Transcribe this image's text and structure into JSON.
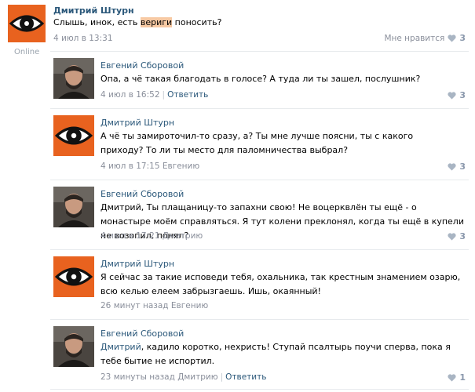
{
  "main": {
    "post": {
      "author": "Дмитрий Штурн",
      "text_before": "Слышь, инок, есть ",
      "text_highlight": "вериги",
      "text_after": " поносить?",
      "timestamp": "4 июл в 13:31",
      "like_label": "Мне нравится",
      "like_count": "3",
      "status": "Online"
    },
    "thread": {
      "comments": [
        {
          "author": "Евгений Сборовой",
          "text": "Опа, а чё такая благодать в голосе? А туда ли ты зашел, послушник?",
          "timestamp": "4 июл в 16:52",
          "reply_label": "Ответить",
          "reply_to": "",
          "like_count": "3"
        },
        {
          "author": "Дмитрий Штурн",
          "text": "А чё ты замироточил-то сразу, а? Ты мне лучше поясни, ты с какого приходу? То ли ты место для паломничества выбрал?",
          "timestamp": "4 июл в 17:15",
          "reply_label": "",
          "reply_to": "Евгению",
          "like_count": "3"
        },
        {
          "author": "Евгений Сборовой",
          "text": "Дмитрий, Ты плащаницу-то запахни свою! Не воцерквлён ты ещё - о монастыре моём справляться. Я тут колени преклонял, когда ты ещё в купели не возопил, понял?",
          "timestamp": "4 июл в 17:21",
          "reply_label": "",
          "reply_to": "Дмитрию",
          "like_count": "3"
        },
        {
          "author": "Дмитрий Штурн",
          "text": "Я сейчас за такие исповеди тебя, охальника, так крестным знамением озарю, всю келью елеем забрызгаешь. Ишь, окаянный!",
          "timestamp": "26 минут назад",
          "reply_label": "",
          "reply_to": "Евгению",
          "like_count": ""
        },
        {
          "author": "Евгений Сборовой",
          "text_name": "Дмитрий",
          "text": ", кадило коротко, нехристь! Ступай псалтырь поучи сперва, пока я тебе бытие не испортил.",
          "timestamp": "23 минуты назад",
          "reply_label": "Ответить",
          "reply_to": "Дмитрию",
          "like_count": "1"
        }
      ]
    }
  },
  "colors": {
    "link": "#2b587a",
    "muted": "#8a8f9b",
    "highlight": "#f7c9a3",
    "avatar_orange": "#e8621f"
  }
}
